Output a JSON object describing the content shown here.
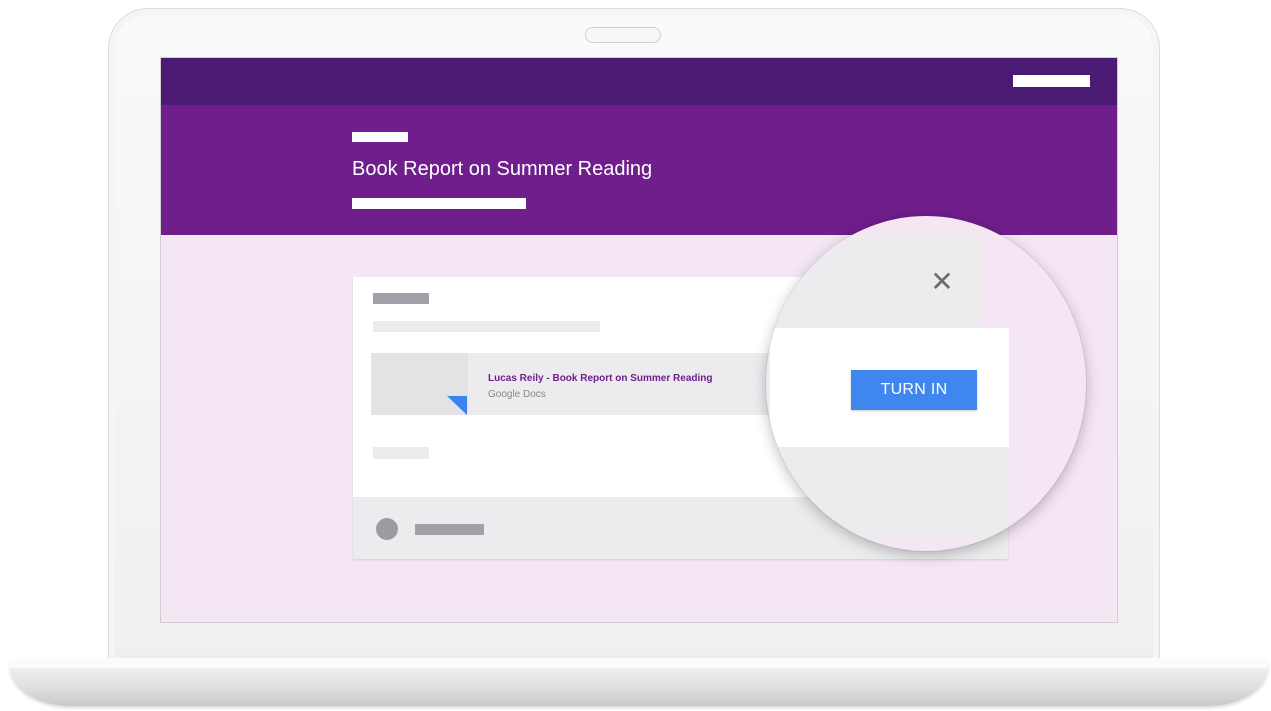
{
  "assignment": {
    "title": "Book Report on Summer Reading"
  },
  "attachment": {
    "title": "Lucas Reily - Book Report on Summer Reading",
    "subtitle": "Google Docs"
  },
  "actions": {
    "turn_in_label": "TURN IN",
    "close_glyph": "✕"
  },
  "colors": {
    "topbar": "#4b1a73",
    "header": "#6f1e8c",
    "background": "#f5e6f4",
    "button": "#3f86ef",
    "doc_corner": "#3b84f0"
  },
  "icons": [
    "close-icon",
    "google-docs-thumbnail-icon",
    "avatar"
  ]
}
